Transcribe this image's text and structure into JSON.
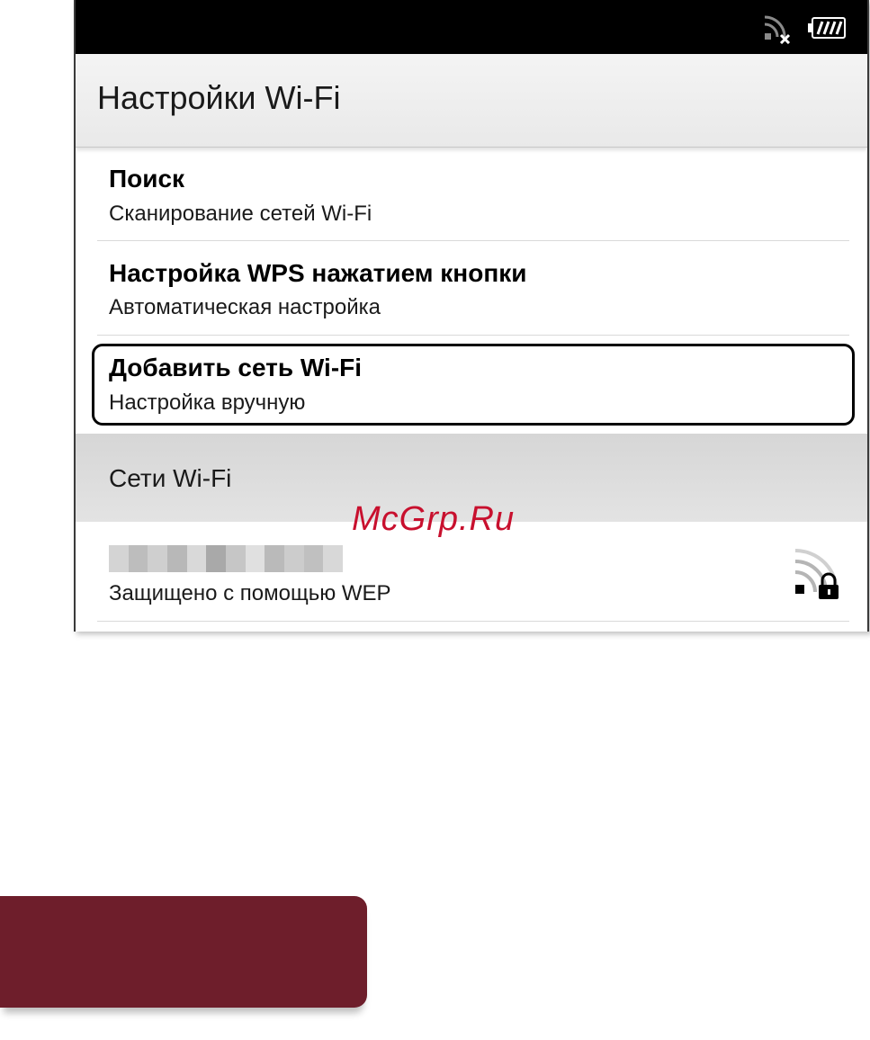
{
  "status_bar": {
    "wifi_icon": "wifi-disconnected-icon",
    "battery_icon": "battery-full-icon"
  },
  "header": {
    "title": "Настройки Wi-Fi"
  },
  "menu": {
    "items": [
      {
        "title": "Поиск",
        "subtitle": "Сканирование сетей Wi-Fi"
      },
      {
        "title": "Настройка WPS нажатием кнопки",
        "subtitle": "Автоматическая настройка"
      },
      {
        "title": "Добавить сеть Wi-Fi",
        "subtitle": "Настройка вручную",
        "highlighted": true
      }
    ]
  },
  "networks": {
    "section_title": "Сети Wi-Fi",
    "items": [
      {
        "security": "Защищено с помощью WEP",
        "icon": "wifi-locked-icon"
      }
    ]
  },
  "watermark": "McGrp.Ru",
  "colors": {
    "status_bar": "#000000",
    "panel": "#6e1e2b",
    "watermark": "#c8102e"
  }
}
